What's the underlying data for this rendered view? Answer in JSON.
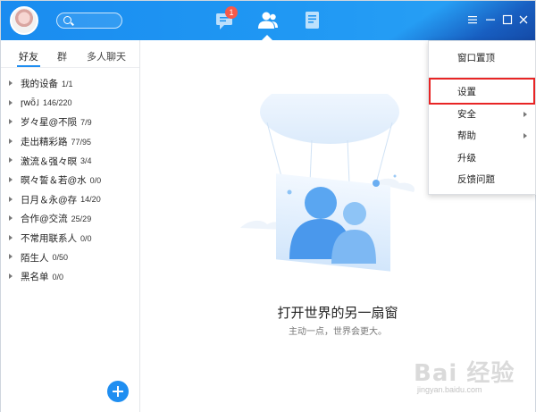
{
  "header": {
    "message_badge": "1",
    "active_nav": "contacts"
  },
  "sidebar": {
    "tabs": [
      {
        "label": "好友",
        "active": true
      },
      {
        "label": "群",
        "active": false
      },
      {
        "label": "多人聊天",
        "active": false
      }
    ],
    "groups": [
      {
        "name": "我的设备",
        "count": "1/1"
      },
      {
        "name": "ɼwȫ˩",
        "count": "146/220"
      },
      {
        "name": "岁々星@不陨",
        "count": "7/9"
      },
      {
        "name": "走出精彩路",
        "count": "77/95"
      },
      {
        "name": "激流＆强々暝",
        "count": "3/4"
      },
      {
        "name": "暝々誓＆若@水",
        "count": "0/0"
      },
      {
        "name": "日月＆永@存",
        "count": "14/20"
      },
      {
        "name": "合作@交流",
        "count": "25/29"
      },
      {
        "name": "不常用联系人",
        "count": "0/0"
      },
      {
        "name": "陌生人",
        "count": "0/50"
      },
      {
        "name": "黑名单",
        "count": "0/0"
      }
    ]
  },
  "main": {
    "headline": "打开世界的另一扇窗",
    "subline": "主动一点，世界会更大。"
  },
  "menu": {
    "items": [
      {
        "label": "窗口置顶",
        "submenu": false
      },
      {
        "label": "设置",
        "submenu": false
      },
      {
        "label": "安全",
        "submenu": true
      },
      {
        "label": "帮助",
        "submenu": true
      },
      {
        "label": "升级",
        "submenu": false
      },
      {
        "label": "反馈问题",
        "submenu": false
      }
    ]
  },
  "watermark": {
    "text": "Bai 经验",
    "url": "jingyan.baidu.com"
  },
  "colors": {
    "accent": "#1f8ef1",
    "highlight": "#e82525",
    "badge": "#f55a4a"
  }
}
